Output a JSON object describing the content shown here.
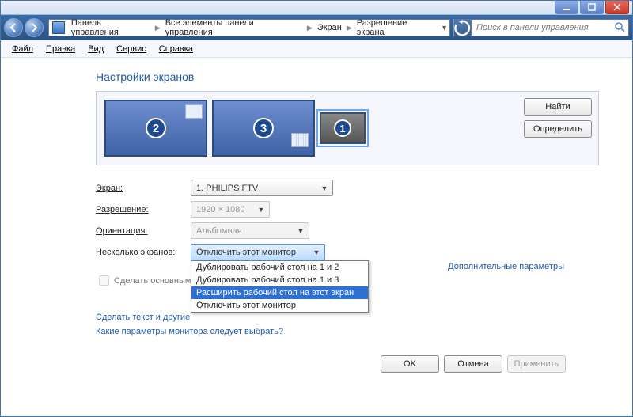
{
  "titlebar": {
    "minimize_tip": "Свернуть",
    "maximize_tip": "Развернуть",
    "close_tip": "Закрыть"
  },
  "breadcrumb": {
    "items": [
      "Панель управления",
      "Все элементы панели управления",
      "Экран",
      "Разрешение экрана"
    ]
  },
  "search": {
    "placeholder": "Поиск в панели управления"
  },
  "menu": {
    "file": "Файл",
    "edit": "Правка",
    "view": "Вид",
    "tools": "Сервис",
    "help": "Справка"
  },
  "page": {
    "title": "Настройки экранов"
  },
  "monitors": {
    "m2": "2",
    "m3": "3",
    "m1": "1"
  },
  "panel_buttons": {
    "find": "Найти",
    "identify": "Определить"
  },
  "labels": {
    "screen": "Экран:",
    "resolution": "Разрешение:",
    "orientation": "Ориентация:",
    "multiple": "Несколько экранов:",
    "make_primary": "Сделать основным монитором"
  },
  "values": {
    "screen": "1. PHILIPS FTV",
    "resolution": "1920 × 1080",
    "orientation": "Альбомная",
    "multiple_selected": "Отключить этот монитор"
  },
  "multi_menu": {
    "items": [
      "Дублировать рабочий стол на 1 и 2",
      "Дублировать рабочий стол на 1 и 3",
      "Расширить рабочий стол на этот экран",
      "Отключить этот монитор"
    ],
    "selected_index": 2
  },
  "links": {
    "advanced": "Дополнительные параметры",
    "text_size": "Сделать текст и другие",
    "which_monitor": "Какие параметры монитора следует выбрать?"
  },
  "buttons": {
    "ok": "OK",
    "cancel": "Отмена",
    "apply": "Применить"
  }
}
